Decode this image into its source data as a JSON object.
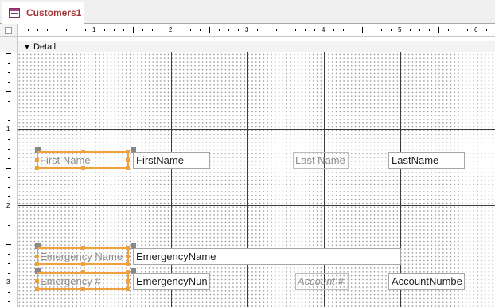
{
  "document": {
    "tab_title": "Customers1"
  },
  "section": {
    "label": "Detail"
  },
  "rulers": {
    "horizontal_numbers": [
      "1",
      "2",
      "3",
      "4",
      "5",
      "6"
    ],
    "vertical_numbers": [
      "1",
      "2",
      "3"
    ]
  },
  "controls": {
    "first_name_label": "First Name",
    "first_name_field": "FirstName",
    "last_name_label": "Last Name",
    "last_name_field": "LastName",
    "emergency_name_label": "Emergency Name",
    "emergency_name_field": "EmergencyName",
    "emergency_num_label": "Emergency #",
    "emergency_num_field": "EmergencyNun",
    "account_label": "Account #",
    "account_field": "AccountNumbe"
  }
}
